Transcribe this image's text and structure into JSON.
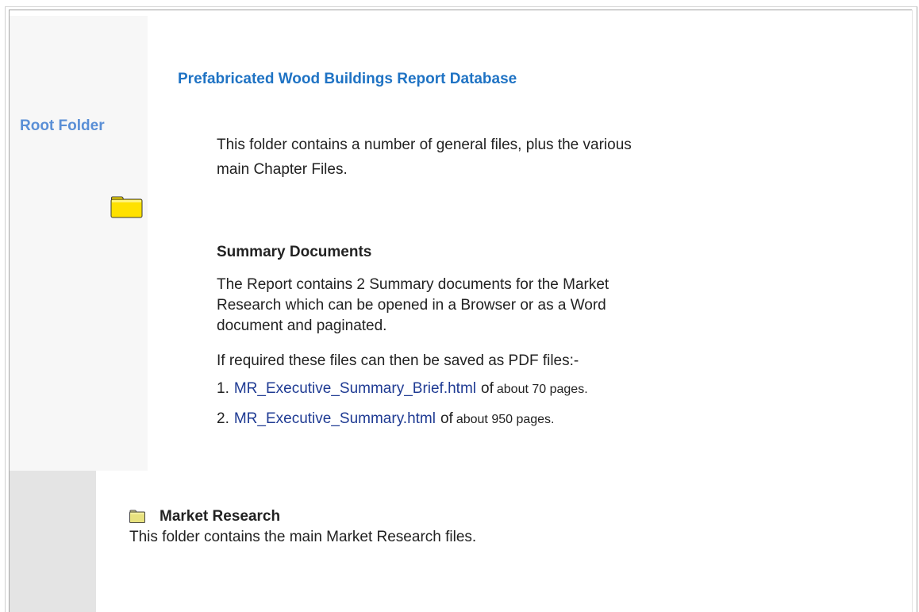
{
  "sidebar": {
    "root_label": "Root Folder",
    "root_icon": "folder-icon"
  },
  "main": {
    "title": "Prefabricated Wood Buildings Report Database",
    "intro_line1": "This folder contains a number of general files, plus the various",
    "intro_line2": "main Chapter Files.",
    "summary": {
      "heading": "Summary Documents",
      "desc_line1": "The Report contains 2 Summary documents for the Market",
      "desc_line2": "Research which can be opened in a Browser or as a Word",
      "desc_line3": "document and paginated.",
      "pdf_note": "If required these files can then be saved as PDF files:-",
      "items": [
        {
          "number": "1.",
          "link": "MR_Executive_Summary_Brief.html",
          "of": "of",
          "size": "about 70 pages."
        },
        {
          "number": "2.",
          "link": "MR_Executive_Summary.html",
          "of": "of",
          "size": "about 950 pages."
        }
      ]
    }
  },
  "market_research": {
    "icon": "folder-icon",
    "heading": "Market Research",
    "description": "This folder contains the main Market Research files."
  },
  "colors": {
    "title": "#1f73c4",
    "root_label": "#5a8fd6",
    "link": "#1f3b93",
    "folder_fill": "#ffe100",
    "sidebar_light": "#f7f7f7",
    "sidebar_dark": "#e4e4e4"
  }
}
